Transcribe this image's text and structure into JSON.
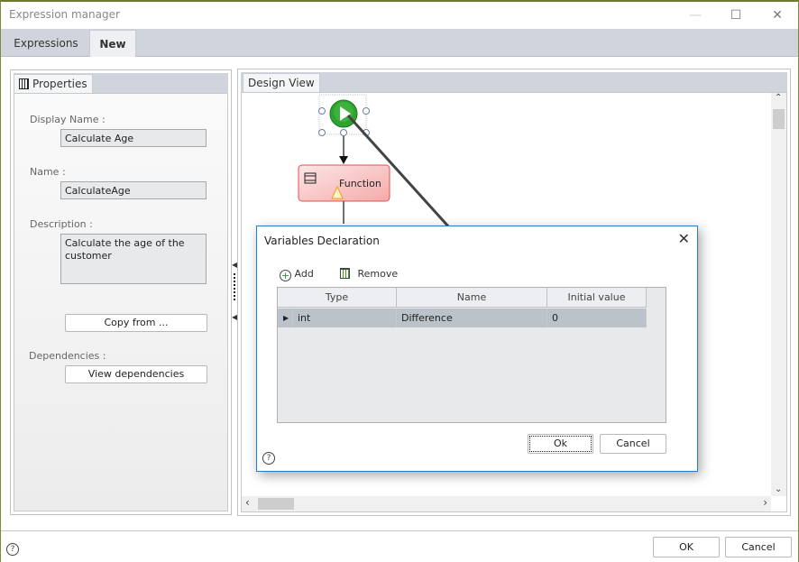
{
  "window": {
    "title": "Expression manager",
    "controls": {
      "minimize": "—",
      "maximize": "☐",
      "close": "✕"
    }
  },
  "tabs": [
    {
      "label": "Expressions",
      "active": false
    },
    {
      "label": "New",
      "active": true
    }
  ],
  "properties": {
    "tab_label": "Properties",
    "display_name_label": "Display Name :",
    "display_name_value": "Calculate Age",
    "name_label": "Name :",
    "name_value": "CalculateAge",
    "description_label": "Description :",
    "description_value": "Calculate the age of the customer",
    "copy_from_button": "Copy from ...",
    "dependencies_label": "Dependencies :",
    "view_dependencies_button": "View dependencies"
  },
  "design_view": {
    "tab_label": "Design View",
    "start_node": "start",
    "function_node_label": "Function",
    "function_node_warning": true
  },
  "variables_dialog": {
    "title": "Variables Declaration",
    "add_label": "Add",
    "remove_label": "Remove",
    "columns": [
      "Type",
      "Name",
      "Initial value"
    ],
    "rows": [
      {
        "type": "int",
        "name": "Difference",
        "initial_value": "0"
      }
    ],
    "ok_button": "Ok",
    "cancel_button": "Cancel",
    "help": "?"
  },
  "footer": {
    "help": "?",
    "ok_button": "OK",
    "cancel_button": "Cancel"
  },
  "colors": {
    "accent_border": "#1e7fd4",
    "tabstrip": "#d0d4dc",
    "start_node": "#2fa12f",
    "function_node_border": "#e05050",
    "selected_row": "#bcc2ca"
  }
}
